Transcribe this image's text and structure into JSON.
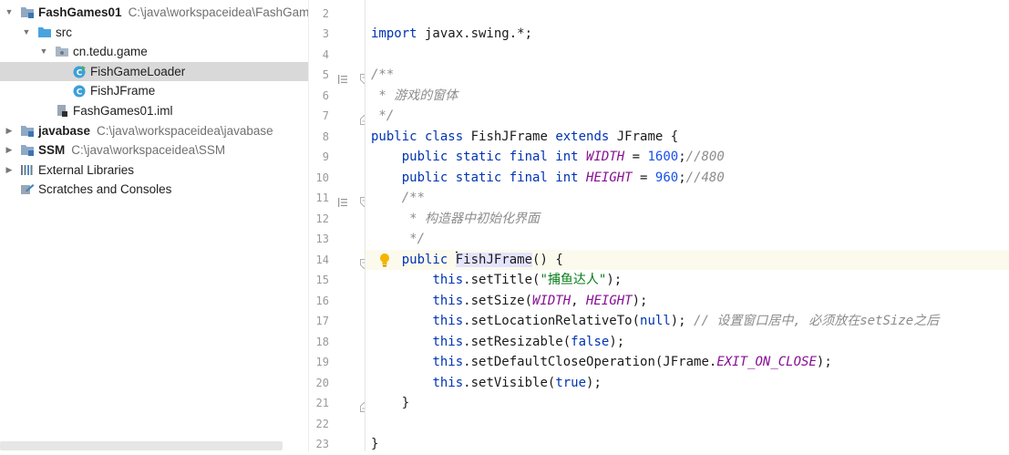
{
  "project_tree": {
    "items": [
      {
        "name": "FashGames01",
        "path": "C:\\java\\workspaceidea\\FashGam",
        "bold": true,
        "arrow": "down",
        "icon": "module-folder-icon",
        "indent": 0
      },
      {
        "name": "src",
        "path": "",
        "bold": false,
        "arrow": "down",
        "icon": "source-folder-icon",
        "indent": 1
      },
      {
        "name": "cn.tedu.game",
        "path": "",
        "bold": false,
        "arrow": "down",
        "icon": "package-icon",
        "indent": 2
      },
      {
        "name": "FishGameLoader",
        "path": "",
        "bold": false,
        "arrow": "",
        "icon": "java-class-runnable-icon",
        "indent": 3,
        "selected": true
      },
      {
        "name": "FishJFrame",
        "path": "",
        "bold": false,
        "arrow": "",
        "icon": "java-class-icon",
        "indent": 3
      },
      {
        "name": "FashGames01.iml",
        "path": "",
        "bold": false,
        "arrow": "",
        "icon": "iml-file-icon",
        "indent": 2
      },
      {
        "name": "javabase",
        "path": "C:\\java\\workspaceidea\\javabase",
        "bold": true,
        "arrow": "right",
        "icon": "module-folder-icon",
        "indent": 0
      },
      {
        "name": "SSM",
        "path": "C:\\java\\workspaceidea\\SSM",
        "bold": true,
        "arrow": "right",
        "icon": "module-folder-icon",
        "indent": 0
      },
      {
        "name": "External Libraries",
        "path": "",
        "bold": false,
        "arrow": "right",
        "icon": "libraries-icon",
        "indent": 0
      },
      {
        "name": "Scratches and Consoles",
        "path": "",
        "bold": false,
        "arrow": "",
        "icon": "scratches-icon",
        "indent": 0
      }
    ]
  },
  "editor": {
    "current_line": "14",
    "colors": {
      "keyword": "#0033b3",
      "field": "#871094",
      "number": "#1750eb",
      "string": "#067d17",
      "comment": "#8c8c8c",
      "current_line_bg": "#fcfaed"
    },
    "lines": [
      {
        "num": "2",
        "tokens": []
      },
      {
        "num": "3",
        "tokens": [
          {
            "t": "kw",
            "v": "import"
          },
          {
            "t": "plain",
            "v": " javax.swing.*;"
          }
        ]
      },
      {
        "num": "4",
        "tokens": []
      },
      {
        "num": "5",
        "mark": true,
        "fold": "open",
        "tokens": [
          {
            "t": "cmt",
            "v": "/**"
          }
        ]
      },
      {
        "num": "6",
        "tokens": [
          {
            "t": "cmt",
            "v": " * 游戏的窗体"
          }
        ]
      },
      {
        "num": "7",
        "fold": "close",
        "tokens": [
          {
            "t": "cmt",
            "v": " */"
          }
        ]
      },
      {
        "num": "8",
        "tokens": [
          {
            "t": "kw",
            "v": "public class"
          },
          {
            "t": "plain",
            "v": " FishJFrame "
          },
          {
            "t": "kw",
            "v": "extends"
          },
          {
            "t": "plain",
            "v": " JFrame {"
          }
        ]
      },
      {
        "num": "9",
        "tokens": [
          {
            "t": "plain",
            "v": "    "
          },
          {
            "t": "kw",
            "v": "public static final int"
          },
          {
            "t": "plain",
            "v": " "
          },
          {
            "t": "fld",
            "v": "WIDTH"
          },
          {
            "t": "plain",
            "v": " = "
          },
          {
            "t": "num",
            "v": "1600"
          },
          {
            "t": "plain",
            "v": ";"
          },
          {
            "t": "cmt",
            "v": "//800"
          }
        ]
      },
      {
        "num": "10",
        "tokens": [
          {
            "t": "plain",
            "v": "    "
          },
          {
            "t": "kw",
            "v": "public static final int"
          },
          {
            "t": "plain",
            "v": " "
          },
          {
            "t": "fld",
            "v": "HEIGHT"
          },
          {
            "t": "plain",
            "v": " = "
          },
          {
            "t": "num",
            "v": "960"
          },
          {
            "t": "plain",
            "v": ";"
          },
          {
            "t": "cmt",
            "v": "//480"
          }
        ]
      },
      {
        "num": "11",
        "mark": true,
        "fold": "open",
        "tokens": [
          {
            "t": "plain",
            "v": "    "
          },
          {
            "t": "cmt",
            "v": "/**"
          }
        ]
      },
      {
        "num": "12",
        "tokens": [
          {
            "t": "plain",
            "v": "    "
          },
          {
            "t": "cmt",
            "v": " * 构造器中初始化界面"
          }
        ]
      },
      {
        "num": "13",
        "tokens": [
          {
            "t": "plain",
            "v": "    "
          },
          {
            "t": "cmt",
            "v": " */"
          }
        ]
      },
      {
        "num": "14",
        "fold": "open",
        "bulb": true,
        "current": true,
        "tokens": [
          {
            "t": "plain",
            "v": "    "
          },
          {
            "t": "kw",
            "v": "public"
          },
          {
            "t": "plain",
            "v": " "
          },
          {
            "t": "caret",
            "v": ""
          },
          {
            "t": "hl",
            "v": "FishJFrame"
          },
          {
            "t": "plain",
            "v": "() {"
          }
        ]
      },
      {
        "num": "15",
        "tokens": [
          {
            "t": "plain",
            "v": "        "
          },
          {
            "t": "kw",
            "v": "this"
          },
          {
            "t": "plain",
            "v": ".setTitle("
          },
          {
            "t": "str",
            "v": "\"捕鱼达人\""
          },
          {
            "t": "plain",
            "v": ");"
          }
        ]
      },
      {
        "num": "16",
        "tokens": [
          {
            "t": "plain",
            "v": "        "
          },
          {
            "t": "kw",
            "v": "this"
          },
          {
            "t": "plain",
            "v": ".setSize("
          },
          {
            "t": "fld",
            "v": "WIDTH"
          },
          {
            "t": "plain",
            "v": ", "
          },
          {
            "t": "fld",
            "v": "HEIGHT"
          },
          {
            "t": "plain",
            "v": ");"
          }
        ]
      },
      {
        "num": "17",
        "tokens": [
          {
            "t": "plain",
            "v": "        "
          },
          {
            "t": "kw",
            "v": "this"
          },
          {
            "t": "plain",
            "v": ".setLocationRelativeTo("
          },
          {
            "t": "kw",
            "v": "null"
          },
          {
            "t": "plain",
            "v": "); "
          },
          {
            "t": "cmt",
            "v": "// 设置窗口居中, 必须放在setSize之后"
          }
        ]
      },
      {
        "num": "18",
        "tokens": [
          {
            "t": "plain",
            "v": "        "
          },
          {
            "t": "kw",
            "v": "this"
          },
          {
            "t": "plain",
            "v": ".setResizable("
          },
          {
            "t": "kw",
            "v": "false"
          },
          {
            "t": "plain",
            "v": ");"
          }
        ]
      },
      {
        "num": "19",
        "tokens": [
          {
            "t": "plain",
            "v": "        "
          },
          {
            "t": "kw",
            "v": "this"
          },
          {
            "t": "plain",
            "v": ".setDefaultCloseOperation(JFrame."
          },
          {
            "t": "fld",
            "v": "EXIT_ON_CLOSE"
          },
          {
            "t": "plain",
            "v": ");"
          }
        ]
      },
      {
        "num": "20",
        "tokens": [
          {
            "t": "plain",
            "v": "        "
          },
          {
            "t": "kw",
            "v": "this"
          },
          {
            "t": "plain",
            "v": ".setVisible("
          },
          {
            "t": "kw",
            "v": "true"
          },
          {
            "t": "plain",
            "v": ");"
          }
        ]
      },
      {
        "num": "21",
        "fold": "close",
        "tokens": [
          {
            "t": "plain",
            "v": "    }"
          }
        ]
      },
      {
        "num": "22",
        "tokens": []
      },
      {
        "num": "23",
        "tokens": [
          {
            "t": "plain",
            "v": "}"
          }
        ]
      }
    ]
  }
}
